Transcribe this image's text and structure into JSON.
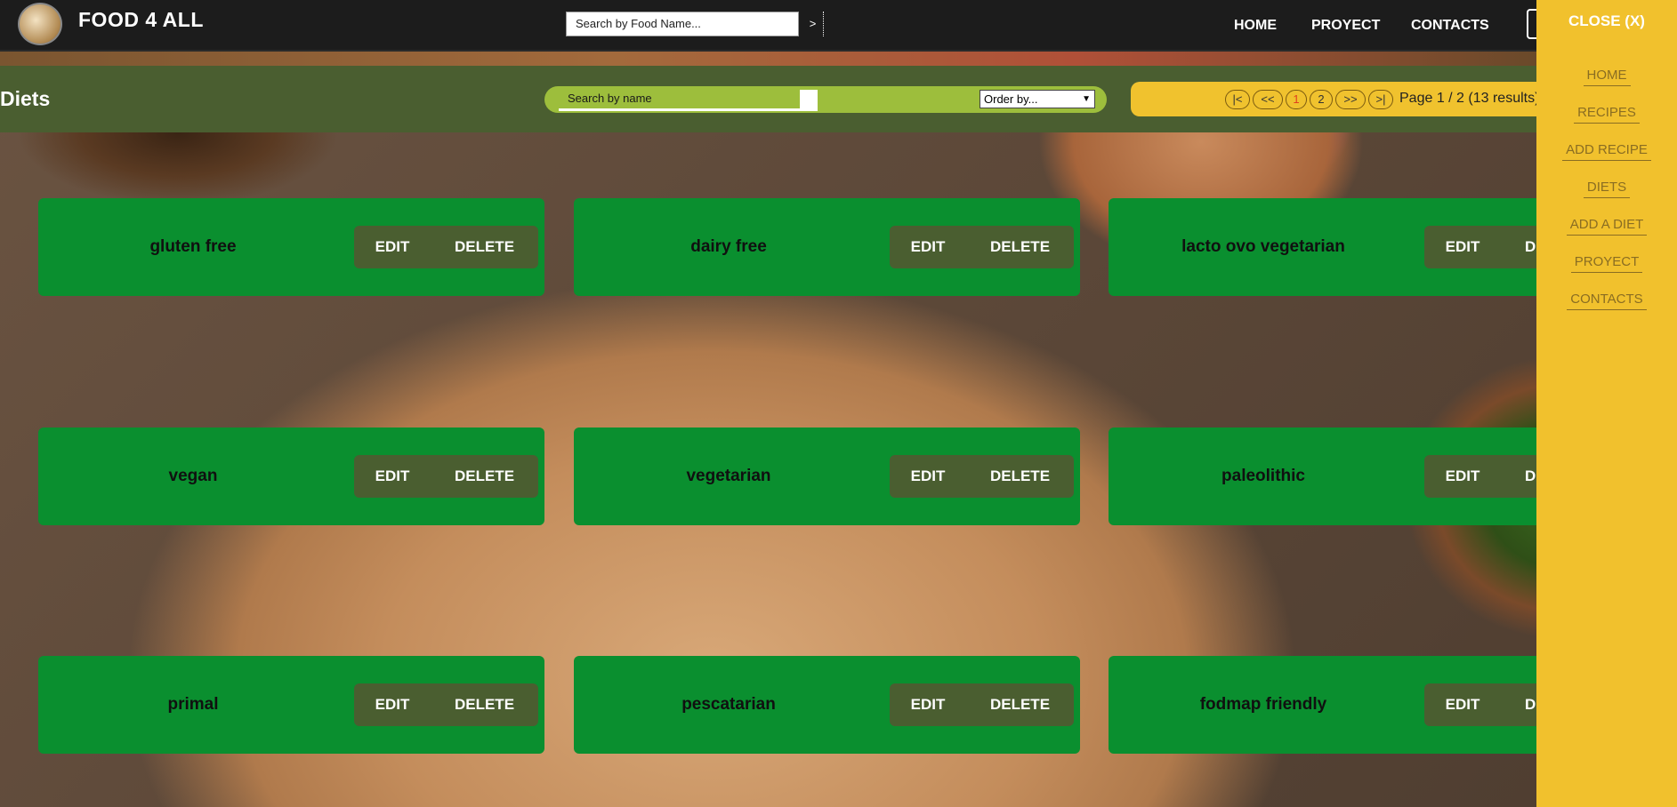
{
  "header": {
    "brand": "FOOD 4 ALL",
    "search_placeholder": "Search by Food Name...",
    "search_button": ">",
    "nav": [
      "HOME",
      "PROYECT",
      "CONTACTS"
    ]
  },
  "filter": {
    "title": "Diets",
    "search_placeholder": "Search by name",
    "order_selected": "Order by...",
    "pager_buttons": [
      "|<",
      "<<",
      "1",
      "2",
      ">>",
      ">|"
    ],
    "active_page": "1",
    "page_info": "Page 1 / 2 (13 results)"
  },
  "cards": [
    {
      "name": "gluten free",
      "edit": "EDIT",
      "delete": "DELETE"
    },
    {
      "name": "dairy free",
      "edit": "EDIT",
      "delete": "DELETE"
    },
    {
      "name": "lacto ovo vegetarian",
      "edit": "EDIT",
      "delete": "DELETE"
    },
    {
      "name": "vegan",
      "edit": "EDIT",
      "delete": "DELETE"
    },
    {
      "name": "vegetarian",
      "edit": "EDIT",
      "delete": "DELETE"
    },
    {
      "name": "paleolithic",
      "edit": "EDIT",
      "delete": "DELETE"
    },
    {
      "name": "primal",
      "edit": "EDIT",
      "delete": "DELETE"
    },
    {
      "name": "pescatarian",
      "edit": "EDIT",
      "delete": "DELETE"
    },
    {
      "name": "fodmap friendly",
      "edit": "EDIT",
      "delete": "DELETE"
    }
  ],
  "sidemenu": {
    "close": "CLOSE (X)",
    "items": [
      "HOME",
      "RECIPES",
      "ADD RECIPE",
      "DIETS",
      "ADD A DIET",
      "PROYECT",
      "CONTACTS"
    ]
  },
  "colors": {
    "header_bg": "#1c1c1c",
    "filterbar_bg": "#4a5e30",
    "card_bg": "#0a8f2f",
    "accent_yellow": "#f1c12d",
    "search_green": "#9dbe3c"
  }
}
